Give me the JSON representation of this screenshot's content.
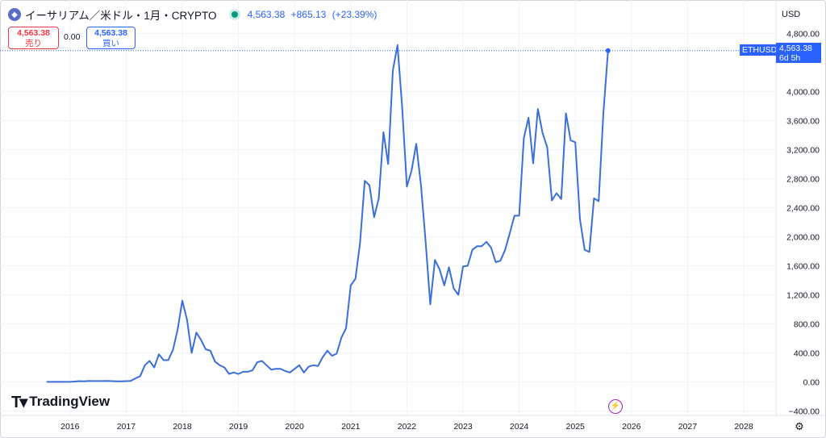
{
  "header": {
    "symbol_title": "イーサリアム／米ドル・1月・CRYPTO",
    "last_price": "4,563.38",
    "change": "+865.13",
    "change_pct": "(+23.39%)"
  },
  "trade": {
    "sell_price": "4,563.38",
    "sell_label": "売り",
    "spread": "0.00",
    "buy_price": "4,563.38",
    "buy_label": "買い"
  },
  "currency": "USD",
  "price_label": {
    "symbol": "ETHUSD",
    "price": "4,563.38",
    "countdown": "6d 5h"
  },
  "branding": {
    "logo_text": "TradingView"
  },
  "colors": {
    "line": "#3a6fd8",
    "accent": "#2962ff",
    "sell": "#f23645",
    "grid": "#f0f3fa"
  },
  "chart_data": {
    "type": "line",
    "series": [
      {
        "name": "ETHUSD",
        "x": [
          "2015-08",
          "2015-09",
          "2015-10",
          "2015-11",
          "2015-12",
          "2016-01",
          "2016-02",
          "2016-03",
          "2016-04",
          "2016-05",
          "2016-06",
          "2016-07",
          "2016-08",
          "2016-09",
          "2016-10",
          "2016-11",
          "2016-12",
          "2017-01",
          "2017-02",
          "2017-03",
          "2017-04",
          "2017-05",
          "2017-06",
          "2017-07",
          "2017-08",
          "2017-09",
          "2017-10",
          "2017-11",
          "2017-12",
          "2018-01",
          "2018-02",
          "2018-03",
          "2018-04",
          "2018-05",
          "2018-06",
          "2018-07",
          "2018-08",
          "2018-09",
          "2018-10",
          "2018-11",
          "2018-12",
          "2019-01",
          "2019-02",
          "2019-03",
          "2019-04",
          "2019-05",
          "2019-06",
          "2019-07",
          "2019-08",
          "2019-09",
          "2019-10",
          "2019-11",
          "2019-12",
          "2020-01",
          "2020-02",
          "2020-03",
          "2020-04",
          "2020-05",
          "2020-06",
          "2020-07",
          "2020-08",
          "2020-09",
          "2020-10",
          "2020-11",
          "2020-12",
          "2021-01",
          "2021-02",
          "2021-03",
          "2021-04",
          "2021-05",
          "2021-06",
          "2021-07",
          "2021-08",
          "2021-09",
          "2021-10",
          "2021-11",
          "2021-12",
          "2022-01",
          "2022-02",
          "2022-03",
          "2022-04",
          "2022-05",
          "2022-06",
          "2022-07",
          "2022-08",
          "2022-09",
          "2022-10",
          "2022-11",
          "2022-12",
          "2023-01",
          "2023-02",
          "2023-03",
          "2023-04",
          "2023-05",
          "2023-06",
          "2023-07",
          "2023-08",
          "2023-09",
          "2023-10",
          "2023-11",
          "2023-12",
          "2024-01",
          "2024-02",
          "2024-03",
          "2024-04",
          "2024-05",
          "2024-06",
          "2024-07",
          "2024-08",
          "2024-09",
          "2024-10",
          "2024-11",
          "2024-12",
          "2025-01",
          "2025-02",
          "2025-03",
          "2025-04",
          "2025-05",
          "2025-06",
          "2025-07",
          "2025-08"
        ],
        "values": [
          1,
          1,
          1,
          1,
          1,
          1,
          6,
          11,
          9,
          14,
          12,
          12,
          12,
          13,
          11,
          9,
          8,
          11,
          16,
          50,
          80,
          230,
          290,
          200,
          380,
          300,
          300,
          440,
          720,
          1120,
          860,
          400,
          680,
          580,
          450,
          430,
          280,
          230,
          200,
          110,
          130,
          110,
          140,
          140,
          160,
          270,
          290,
          230,
          170,
          180,
          180,
          150,
          130,
          180,
          230,
          130,
          210,
          230,
          220,
          340,
          430,
          360,
          390,
          610,
          740,
          1330,
          1420,
          1920,
          2770,
          2710,
          2270,
          2530,
          3440,
          3000,
          4290,
          4640,
          3780,
          2690,
          2910,
          3280,
          2720,
          1940,
          1070,
          1680,
          1550,
          1330,
          1580,
          1290,
          1200,
          1590,
          1600,
          1820,
          1870,
          1870,
          1930,
          1850,
          1650,
          1670,
          1820,
          2050,
          2290,
          2290,
          3360,
          3640,
          3010,
          3760,
          3430,
          3230,
          2500,
          2600,
          2520,
          3700,
          3330,
          3300,
          2240,
          1820,
          1790,
          2530,
          2490,
          3700,
          4563.38
        ]
      }
    ],
    "x_ticks": [
      "2016",
      "2017",
      "2018",
      "2019",
      "2020",
      "2021",
      "2022",
      "2023",
      "2024",
      "2025",
      "2026",
      "2027",
      "2028"
    ],
    "y_ticks": [
      "4,800.00",
      "4,000.00",
      "3,600.00",
      "3,200.00",
      "2,800.00",
      "2,400.00",
      "2,000.00",
      "1,600.00",
      "1,200.00",
      "800.00",
      "400.00",
      "0.00",
      "−400.00"
    ],
    "ylim": [
      -400,
      4800
    ],
    "xlim": [
      "2015-02",
      "2028-07"
    ],
    "grid": true,
    "last_value": 4563.38
  }
}
